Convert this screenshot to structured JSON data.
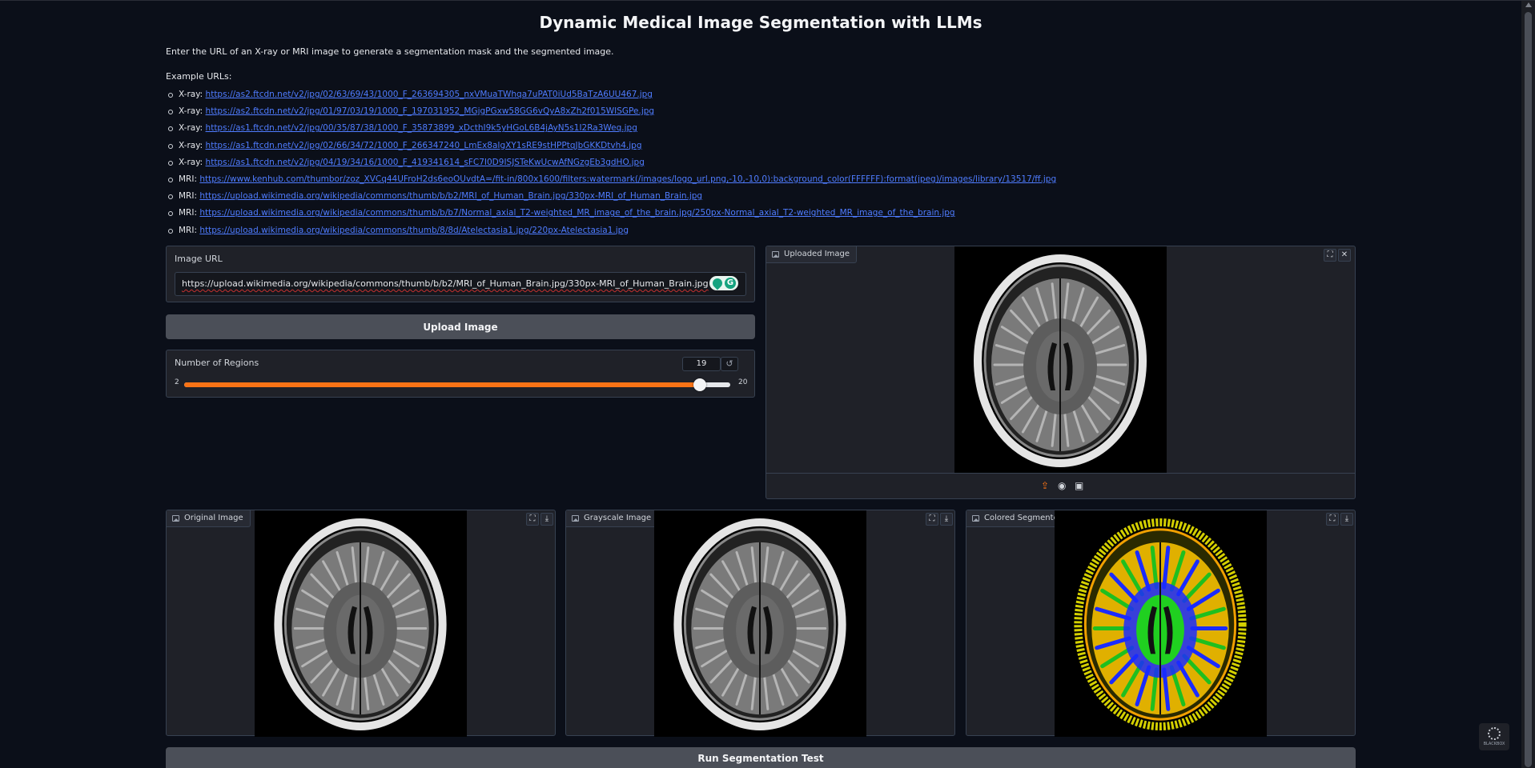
{
  "header": {
    "title": "Dynamic Medical Image Segmentation with LLMs",
    "intro": "Enter the URL of an X-ray or MRI image to generate a segmentation mask and the segmented image.",
    "examples_title": "Example URLs:"
  },
  "examples": [
    {
      "type": "X-ray:",
      "url": "https://as2.ftcdn.net/v2/jpg/02/63/69/43/1000_F_263694305_nxVMuaTWhqa7uPAT0iUd5BaTzA6UU467.jpg"
    },
    {
      "type": "X-ray:",
      "url": "https://as2.ftcdn.net/v2/jpg/01/97/03/19/1000_F_197031952_MGjgPGxw58GG6vQyA8xZh2f015WISGPe.jpg"
    },
    {
      "type": "X-ray:",
      "url": "https://as1.ftcdn.net/v2/jpg/00/35/87/38/1000_F_35873899_xDcthI9k5yHGoL6B4jAyN5s1I2Ra3Weq.jpg"
    },
    {
      "type": "X-ray:",
      "url": "https://as1.ftcdn.net/v2/jpg/02/66/34/72/1000_F_266347240_LmEx8aIgXY1sRE9stHPPtqJbGKKDtvh4.jpg"
    },
    {
      "type": "X-ray:",
      "url": "https://as1.ftcdn.net/v2/jpg/04/19/34/16/1000_F_419341614_sFC7I0D9ISJSTeKwUcwAfNGzgEb3gdHO.jpg"
    },
    {
      "type": "MRI:",
      "url": "https://www.kenhub.com/thumbor/zoz_XVCq44UFroH2ds6eoOUvdtA=/fit-in/800x1600/filters:watermark(/images/logo_url.png,-10,-10,0):background_color(FFFFFF):format(jpeg)/images/library/13517/ff.jpg"
    },
    {
      "type": "MRI:",
      "url": "https://upload.wikimedia.org/wikipedia/commons/thumb/b/b2/MRI_of_Human_Brain.jpg/330px-MRI_of_Human_Brain.jpg"
    },
    {
      "type": "MRI:",
      "url": "https://upload.wikimedia.org/wikipedia/commons/thumb/b/b7/Normal_axial_T2-weighted_MR_image_of_the_brain.jpg/250px-Normal_axial_T2-weighted_MR_image_of_the_brain.jpg"
    },
    {
      "type": "MRI:",
      "url": "https://upload.wikimedia.org/wikipedia/commons/thumb/8/8d/Atelectasia1.jpg/220px-Atelectasia1.jpg"
    }
  ],
  "input_panel": {
    "label": "Image URL",
    "value": "https://upload.wikimedia.org/wikipedia/commons/thumb/b/b2/MRI_of_Human_Brain.jpg/330px-MRI_of_Human_Brain.jpg"
  },
  "upload_button": "Upload Image",
  "regions": {
    "label": "Number of Regions",
    "value": 19,
    "min": 2,
    "max": 20,
    "reset_icon": "↺"
  },
  "uploaded_panel": {
    "label": "Uploaded Image",
    "icons": [
      "fullscreen-icon",
      "close-icon",
      "upload-icon",
      "webcam-icon",
      "clipboard-icon"
    ]
  },
  "outputs": [
    {
      "label": "Original Image"
    },
    {
      "label": "Grayscale Image"
    },
    {
      "label": "Colored Segmented Image"
    }
  ],
  "run_button": "Run Segmentation Test",
  "logo_text": "BLACKBOX",
  "colors": {
    "background": "#0b0f19",
    "panel": "#1f2128",
    "accent": "#f97316",
    "link": "#4f7cff",
    "button": "#4b4f58"
  }
}
